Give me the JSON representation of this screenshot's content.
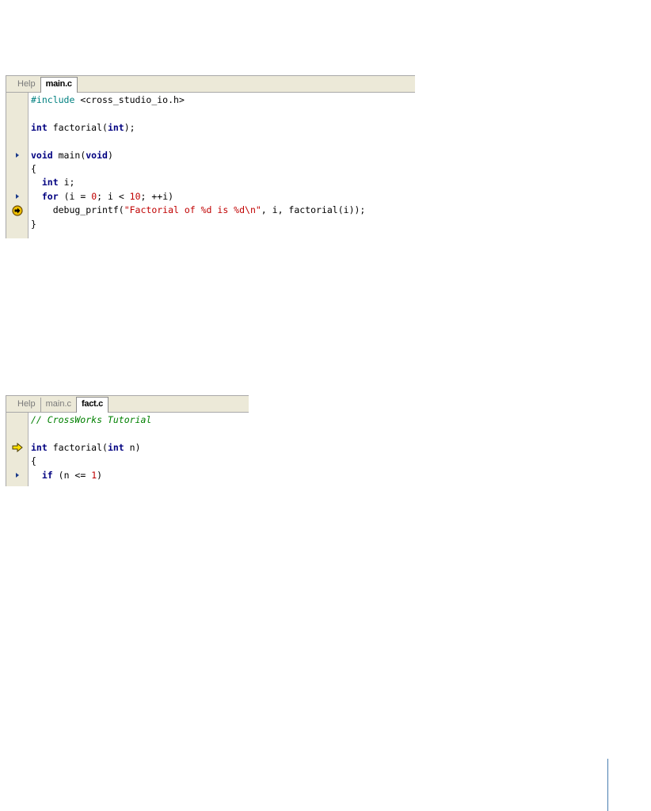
{
  "editor1": {
    "tabs": [
      {
        "label": "Help",
        "active": false
      },
      {
        "label": "main.c",
        "active": true
      }
    ],
    "lines": [
      [
        {
          "t": "#include",
          "c": "pp"
        },
        {
          "t": " <cross_studio_io.h>",
          "c": ""
        }
      ],
      [],
      [
        {
          "t": "int",
          "c": "kw"
        },
        {
          "t": " factorial(",
          "c": ""
        },
        {
          "t": "int",
          "c": "kw"
        },
        {
          "t": ");",
          "c": ""
        }
      ],
      [],
      [
        {
          "t": "void",
          "c": "kw"
        },
        {
          "t": " main(",
          "c": ""
        },
        {
          "t": "void",
          "c": "kw"
        },
        {
          "t": ")",
          "c": ""
        }
      ],
      [
        {
          "t": "{",
          "c": ""
        }
      ],
      [
        {
          "t": "  ",
          "c": ""
        },
        {
          "t": "int",
          "c": "kw"
        },
        {
          "t": " i;",
          "c": ""
        }
      ],
      [
        {
          "t": "  ",
          "c": ""
        },
        {
          "t": "for",
          "c": "kw"
        },
        {
          "t": " (i = ",
          "c": ""
        },
        {
          "t": "0",
          "c": "num"
        },
        {
          "t": "; i < ",
          "c": ""
        },
        {
          "t": "10",
          "c": "num"
        },
        {
          "t": "; ++i)",
          "c": ""
        }
      ],
      [
        {
          "t": "    debug_printf(",
          "c": ""
        },
        {
          "t": "\"Factorial of %d is %d\\n\"",
          "c": "str"
        },
        {
          "t": ", i, factorial(i));",
          "c": ""
        }
      ],
      [
        {
          "t": "}",
          "c": ""
        }
      ]
    ],
    "markers": [
      {
        "line": 4,
        "type": "breakpoint-small"
      },
      {
        "line": 7,
        "type": "breakpoint-small"
      },
      {
        "line": 8,
        "type": "current-line-circle"
      }
    ]
  },
  "editor2": {
    "tabs": [
      {
        "label": "Help",
        "active": false
      },
      {
        "label": "main.c",
        "active": false
      },
      {
        "label": "fact.c",
        "active": true
      }
    ],
    "lines": [
      [
        {
          "t": "// CrossWorks Tutorial",
          "c": "cm"
        }
      ],
      [],
      [
        {
          "t": "int",
          "c": "kw"
        },
        {
          "t": " factorial(",
          "c": ""
        },
        {
          "t": "int",
          "c": "kw"
        },
        {
          "t": " n)",
          "c": ""
        }
      ],
      [
        {
          "t": "{",
          "c": ""
        }
      ],
      [
        {
          "t": "  ",
          "c": ""
        },
        {
          "t": "if",
          "c": "kw"
        },
        {
          "t": " (n <= ",
          "c": ""
        },
        {
          "t": "1",
          "c": "num"
        },
        {
          "t": ")",
          "c": ""
        }
      ]
    ],
    "markers": [
      {
        "line": 2,
        "type": "current-line-arrow"
      },
      {
        "line": 4,
        "type": "breakpoint-small"
      }
    ]
  },
  "colors": {
    "keyword": "#000080",
    "preprocessor": "#008080",
    "string": "#c00000",
    "comment": "#008000",
    "marker": "#f0c000"
  }
}
